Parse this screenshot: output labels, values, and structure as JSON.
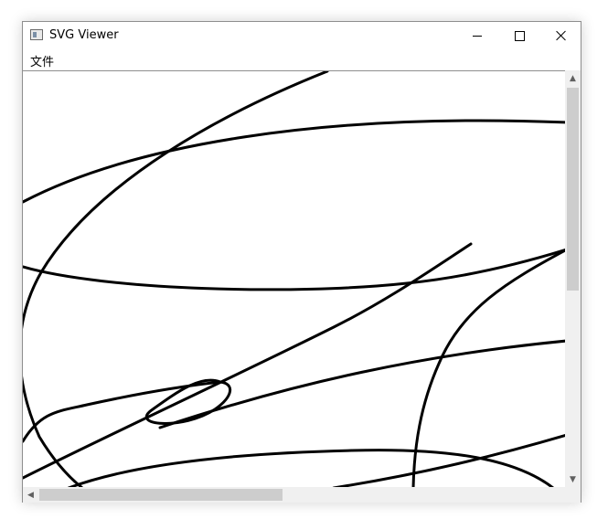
{
  "window": {
    "title": "SVG Viewer",
    "icon": "app-window-icon"
  },
  "title_controls": {
    "minimize_icon": "minimize-icon",
    "maximize_icon": "maximize-icon",
    "close_icon": "close-icon"
  },
  "menubar": {
    "items": [
      {
        "label": "文件"
      }
    ]
  },
  "drawing": {
    "stroke_color": "#000000",
    "background": "#ffffff"
  },
  "scrollbars": {
    "track_color": "#f0f0f0",
    "thumb_color": "#cdcdcd",
    "arrows": {
      "up": "▲",
      "down": "▼",
      "left": "◀",
      "right": "▶"
    }
  }
}
